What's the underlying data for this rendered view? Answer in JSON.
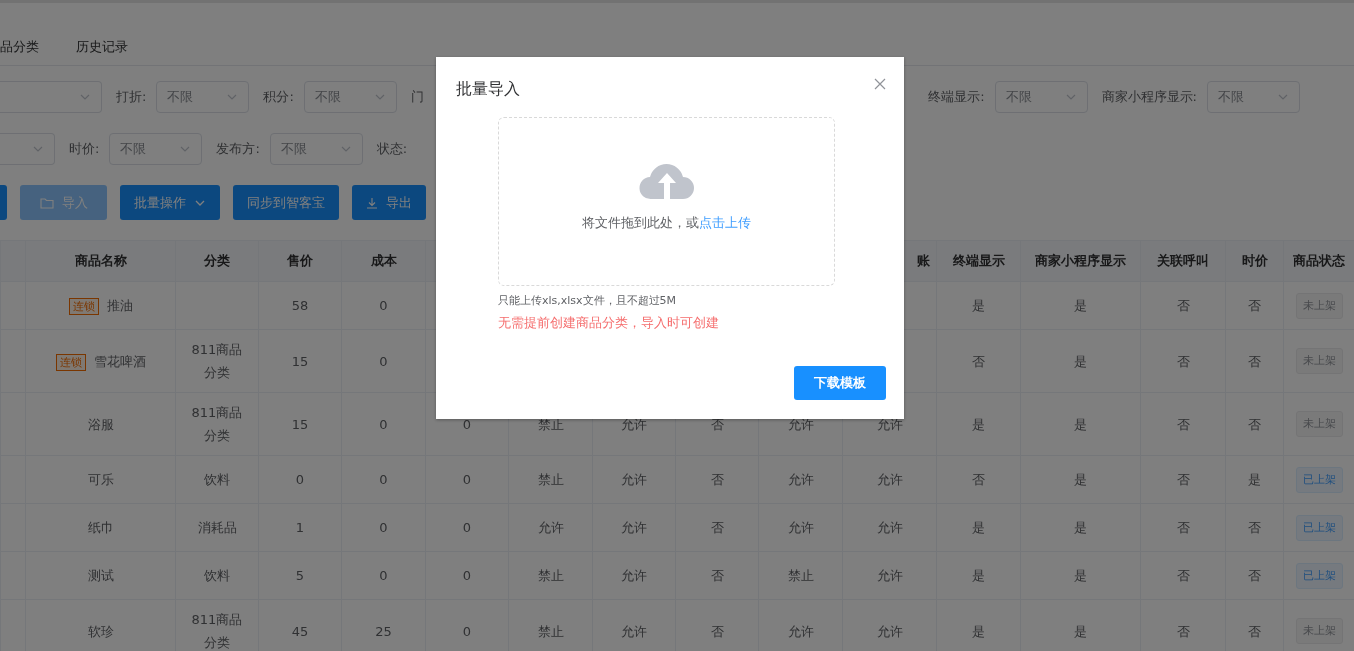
{
  "tabs": [
    {
      "label": "品分类",
      "selected": false
    },
    {
      "label": "历史记录",
      "selected": false
    }
  ],
  "filter_rows": [
    {
      "left": [
        {
          "label": "打折:",
          "value": "不限"
        },
        {
          "label": "积分:",
          "value": "不限"
        },
        {
          "label": "门"
        }
      ],
      "right": [
        {
          "label": "终端显示:",
          "value": "不限"
        },
        {
          "label": "商家小程序显示:",
          "value": "不限"
        }
      ]
    },
    {
      "left": [
        {
          "label": "时价:",
          "value": "不限"
        },
        {
          "label": "发布方:",
          "value": "不限"
        },
        {
          "label": "状态:"
        }
      ],
      "right": []
    }
  ],
  "buttons": [
    {
      "label": "导入",
      "kind": "folder",
      "disabled": true
    },
    {
      "label": "批量操作",
      "kind": "dropdown",
      "disabled": false
    },
    {
      "label": "同步到智客宝",
      "kind": "plain",
      "disabled": false
    },
    {
      "label": "导出",
      "kind": "download",
      "disabled": false
    }
  ],
  "table": {
    "columns": [
      "商品名称",
      "分类",
      "售价",
      "成本",
      null,
      null,
      null,
      null,
      null,
      "账",
      "终端显示",
      "商家小程序显示",
      "关联呼叫",
      "时价",
      "商品状态"
    ],
    "rows": [
      {
        "tag": "连锁",
        "cells": [
          "推油",
          null,
          "58",
          "0",
          null,
          null,
          null,
          null,
          null,
          null,
          "是",
          "是",
          "否",
          "否"
        ],
        "status": "未上架",
        "listed": false
      },
      {
        "tag": "连锁",
        "cells": [
          "雪花啤酒",
          "811商品分类",
          "15",
          "0",
          null,
          null,
          null,
          null,
          null,
          null,
          "否",
          "是",
          "否",
          "否"
        ],
        "status": "未上架",
        "listed": false
      },
      {
        "cells": [
          "浴服",
          "811商品分类",
          "15",
          "0",
          "0",
          "禁止",
          "允许",
          "否",
          "允许",
          "允许",
          "是",
          "是",
          "否",
          "否"
        ],
        "status": "未上架",
        "listed": false
      },
      {
        "cells": [
          "可乐",
          "饮料",
          "0",
          "0",
          "0",
          "禁止",
          "允许",
          "否",
          "允许",
          "允许",
          "否",
          "是",
          "否",
          "是"
        ],
        "status": "已上架",
        "listed": true
      },
      {
        "cells": [
          "纸巾",
          "消耗品",
          "1",
          "0",
          "0",
          "允许",
          "允许",
          "否",
          "允许",
          "允许",
          "是",
          "是",
          "否",
          "否"
        ],
        "status": "已上架",
        "listed": true
      },
      {
        "cells": [
          "测试",
          "饮料",
          "5",
          "0",
          "0",
          "禁止",
          "允许",
          "否",
          "禁止",
          "允许",
          "是",
          "是",
          "否",
          "否"
        ],
        "status": "已上架",
        "listed": true
      },
      {
        "cells": [
          "软珍",
          "811商品分类",
          "45",
          "25",
          "0",
          "禁止",
          "允许",
          "否",
          "允许",
          "允许",
          "是",
          "是",
          "否",
          "否"
        ],
        "status": "未上架",
        "listed": false
      }
    ]
  },
  "dialog": {
    "title": "批量导入",
    "upload_hint": "将文件拖到此处，或",
    "upload_link": "点击上传",
    "tip": "只能上传xls,xlsx文件，且不超过5M",
    "note": "无需提前创建商品分类，导入时可创建",
    "button": "下载模板"
  }
}
